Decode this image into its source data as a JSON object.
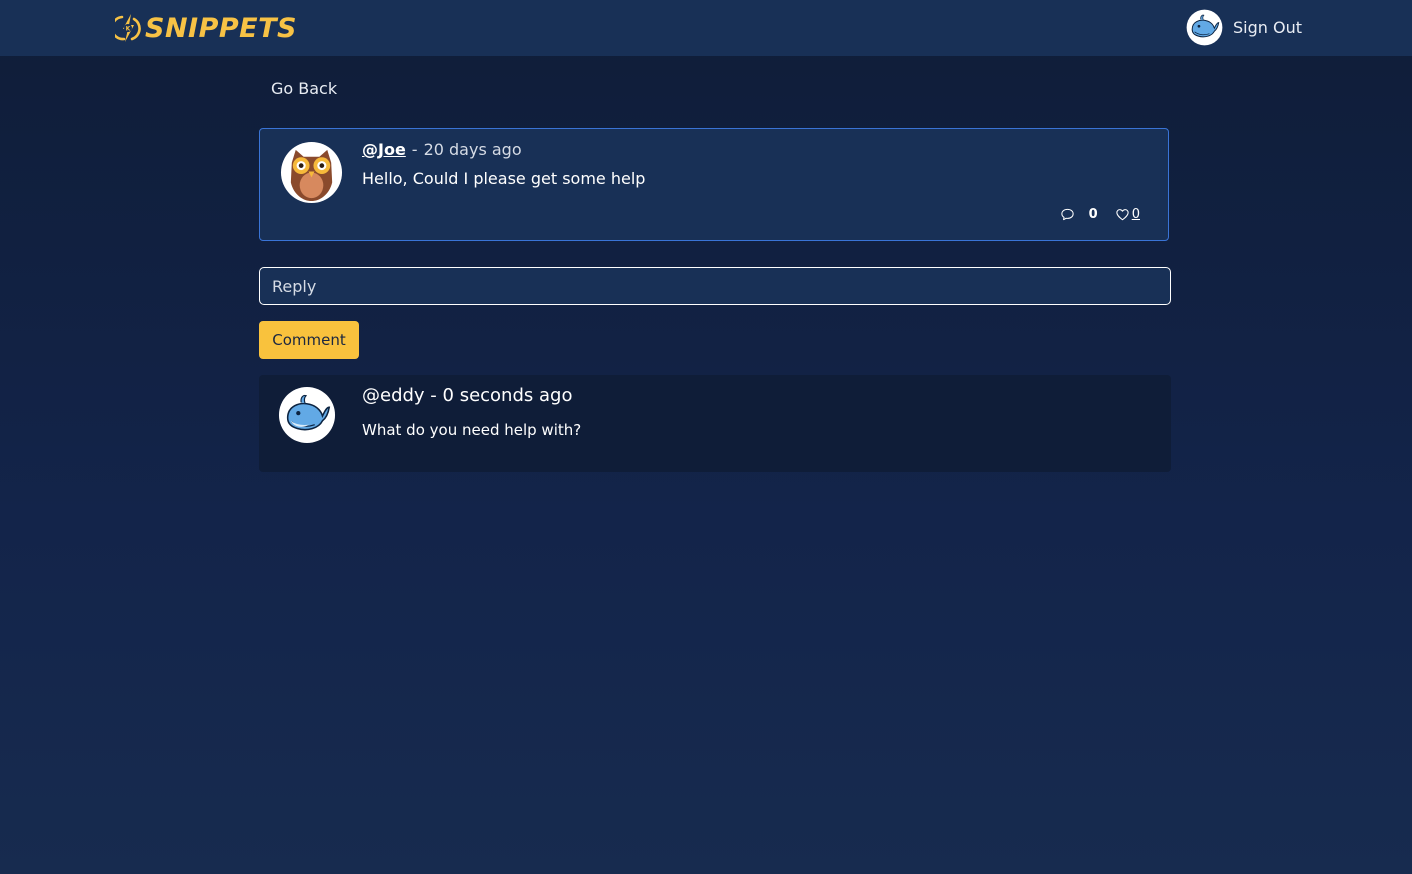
{
  "navbar": {
    "brand": "SNIPPETS",
    "signout_label": "Sign Out"
  },
  "goback_label": "Go Back",
  "post": {
    "username": "@Joe",
    "separator": "-",
    "time": "20 days ago",
    "body": "Hello, Could I please get some help",
    "comment_count": "0",
    "like_count": "0"
  },
  "reply_form": {
    "placeholder": "Reply",
    "submit_label": "Comment"
  },
  "replies": [
    {
      "meta": "@eddy - 0 seconds ago",
      "body": "What do you need help with?"
    }
  ],
  "colors": {
    "accent": "#f9c23d",
    "navbar": "#183056",
    "background": "#13244a",
    "post_border": "#3a74d6"
  },
  "icons": {
    "logo": "snippets-logo-icon",
    "avatar_owl": "owl-avatar",
    "avatar_whale": "whale-avatar",
    "comment": "comment-bubble-icon",
    "like": "heart-icon"
  }
}
